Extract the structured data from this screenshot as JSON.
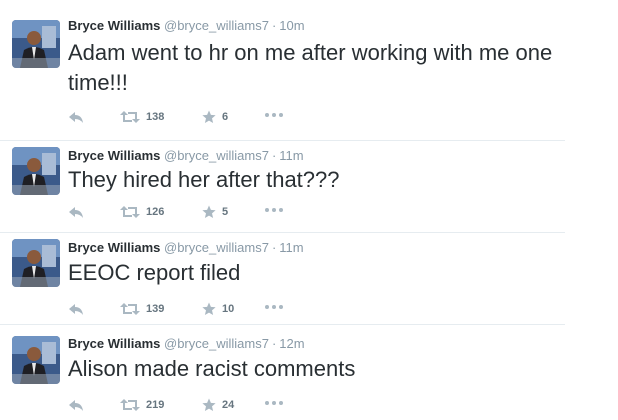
{
  "tweets": [
    {
      "name": "Bryce Williams",
      "handle": "@bryce_williams7",
      "separator": "·",
      "time": "10m",
      "text": "Adam went to hr on me after working with me one time!!!",
      "retweets": "138",
      "favorites": "6"
    },
    {
      "name": "Bryce Williams",
      "handle": "@bryce_williams7",
      "separator": "·",
      "time": "11m",
      "text": "They hired her after that???",
      "retweets": "126",
      "favorites": "5"
    },
    {
      "name": "Bryce Williams",
      "handle": "@bryce_williams7",
      "separator": "·",
      "time": "11m",
      "text": "EEOC report filed",
      "retweets": "139",
      "favorites": "10"
    },
    {
      "name": "Bryce Williams",
      "handle": "@bryce_williams7",
      "separator": "·",
      "time": "12m",
      "text": "Alison made racist comments",
      "retweets": "219",
      "favorites": "24"
    }
  ],
  "icons": {
    "reply": "reply-icon",
    "retweet": "retweet-icon",
    "favorite": "star-icon",
    "more": "more-icon",
    "avatar": "avatar"
  },
  "colors": {
    "icon_gray": "#aab8c2",
    "text_gray": "#8899a6",
    "text_dark": "#292f33"
  }
}
